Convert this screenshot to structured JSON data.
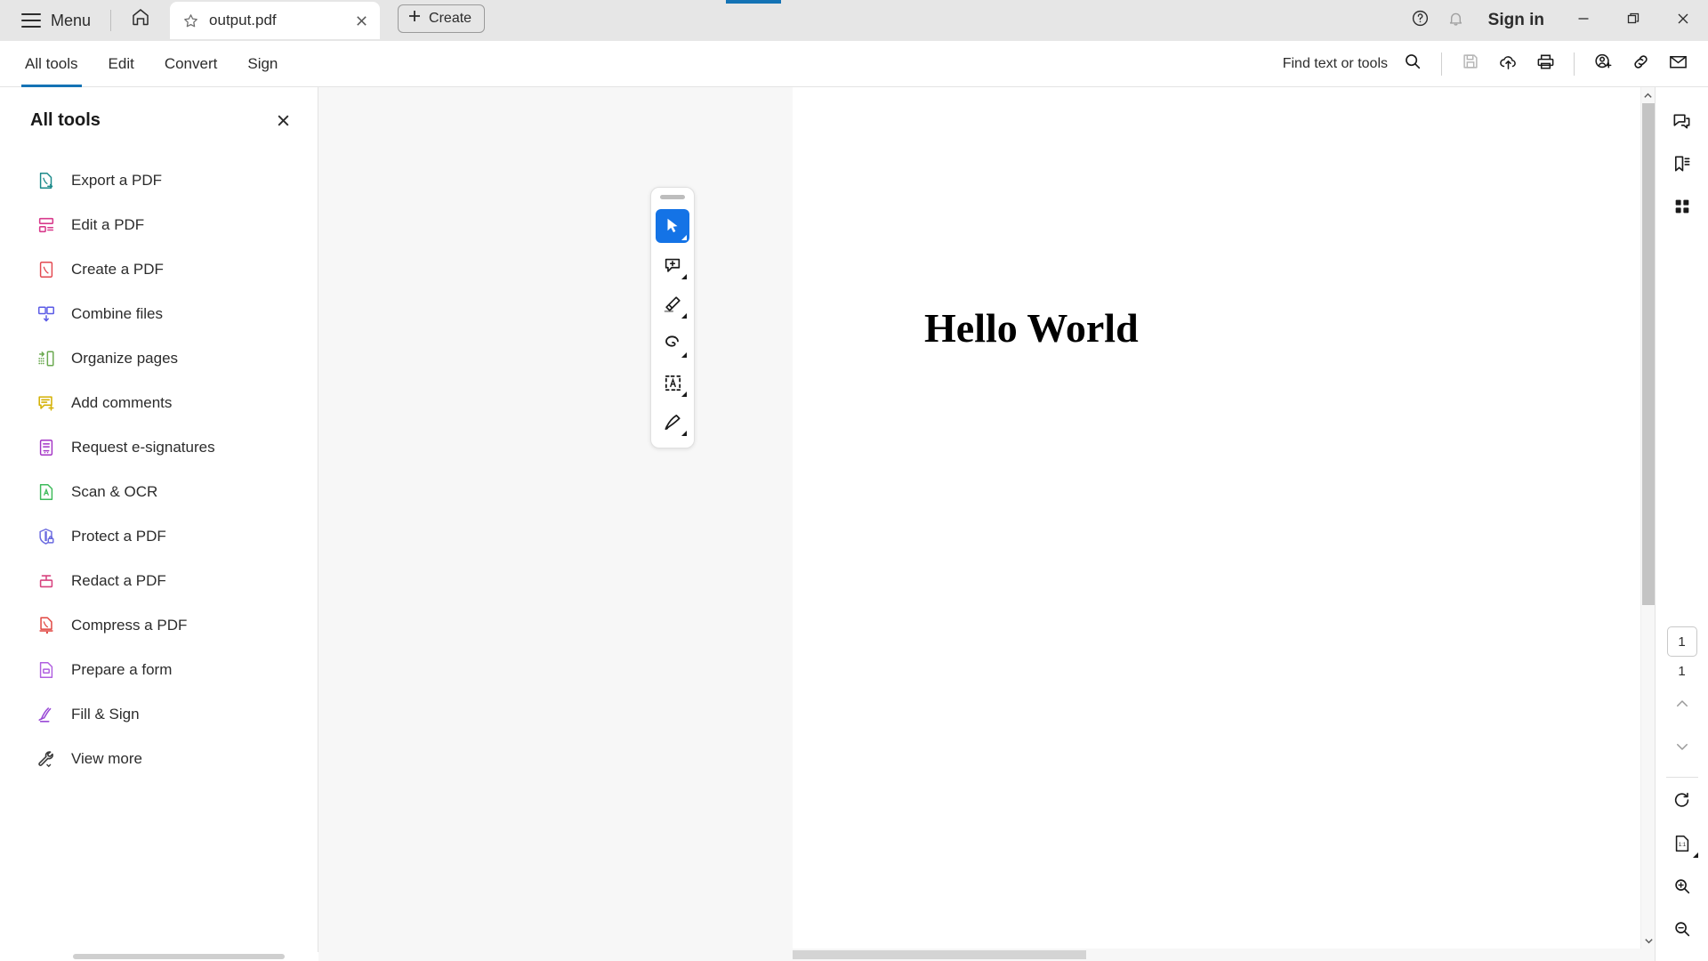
{
  "titlebar": {
    "menu_label": "Menu",
    "home_icon": "home-icon",
    "tab": {
      "title": "output.pdf",
      "star_icon": "star-icon",
      "close_icon": "close-icon"
    },
    "create_label": "Create",
    "help_icon": "help-circle-icon",
    "bell_icon": "bell-icon",
    "signin_label": "Sign in",
    "minimize_icon": "minimize-icon",
    "restore_icon": "restore-icon",
    "close_window_icon": "close-icon",
    "accent_color": "#1473b5"
  },
  "cmdbar": {
    "tabs": [
      {
        "label": "All tools",
        "active": true
      },
      {
        "label": "Edit",
        "active": false
      },
      {
        "label": "Convert",
        "active": false
      },
      {
        "label": "Sign",
        "active": false
      }
    ],
    "find_label": "Find text or tools",
    "icons": [
      "search-icon",
      "save-icon",
      "upload-cloud-icon",
      "print-icon",
      "add-person-icon",
      "link-icon",
      "mail-icon"
    ]
  },
  "leftpanel": {
    "title": "All tools",
    "close_icon": "close-icon",
    "tools": [
      {
        "label": "Export a PDF",
        "icon": "export-pdf-icon",
        "color": "#1b8a8a"
      },
      {
        "label": "Edit a PDF",
        "icon": "edit-pdf-icon",
        "color": "#d83a8c"
      },
      {
        "label": "Create a PDF",
        "icon": "create-pdf-icon",
        "color": "#e34850"
      },
      {
        "label": "Combine files",
        "icon": "combine-files-icon",
        "color": "#5a5ae6"
      },
      {
        "label": "Organize pages",
        "icon": "organize-pages-icon",
        "color": "#6aa84f"
      },
      {
        "label": "Add comments",
        "icon": "add-comments-icon",
        "color": "#d4b106"
      },
      {
        "label": "Request e-signatures",
        "icon": "request-esign-icon",
        "color": "#a435c6"
      },
      {
        "label": "Scan & OCR",
        "icon": "scan-ocr-icon",
        "color": "#3dbb5a"
      },
      {
        "label": "Protect a PDF",
        "icon": "protect-pdf-icon",
        "color": "#6b6be0"
      },
      {
        "label": "Redact a PDF",
        "icon": "redact-pdf-icon",
        "color": "#d8437f"
      },
      {
        "label": "Compress a PDF",
        "icon": "compress-pdf-icon",
        "color": "#e0443f"
      },
      {
        "label": "Prepare a form",
        "icon": "prepare-form-icon",
        "color": "#b05fe0"
      },
      {
        "label": "Fill & Sign",
        "icon": "fill-sign-icon",
        "color": "#9a4ad6"
      },
      {
        "label": "View more",
        "icon": "view-more-icon",
        "color": "#3c3c3c"
      }
    ]
  },
  "float_toolbar": {
    "grip": "drag-handle",
    "buttons": [
      {
        "name": "select-tool",
        "active": true
      },
      {
        "name": "comment-tool",
        "active": false
      },
      {
        "name": "highlight-tool",
        "active": false
      },
      {
        "name": "draw-tool",
        "active": false
      },
      {
        "name": "text-box-tool",
        "active": false
      },
      {
        "name": "signature-tool",
        "active": false
      }
    ],
    "active_color": "#1473e6"
  },
  "document": {
    "text": "Hello World"
  },
  "rightrail": {
    "top_icons": [
      "comment-panel-icon",
      "bookmark-panel-icon",
      "thumbnail-panel-icon"
    ],
    "page_current": "1",
    "page_total": "1",
    "prev_icon": "chevron-up-icon",
    "next_icon": "chevron-down-icon",
    "bottom_icons": [
      "rotate-icon",
      "fit-page-icon",
      "zoom-in-icon",
      "zoom-out-icon"
    ]
  }
}
